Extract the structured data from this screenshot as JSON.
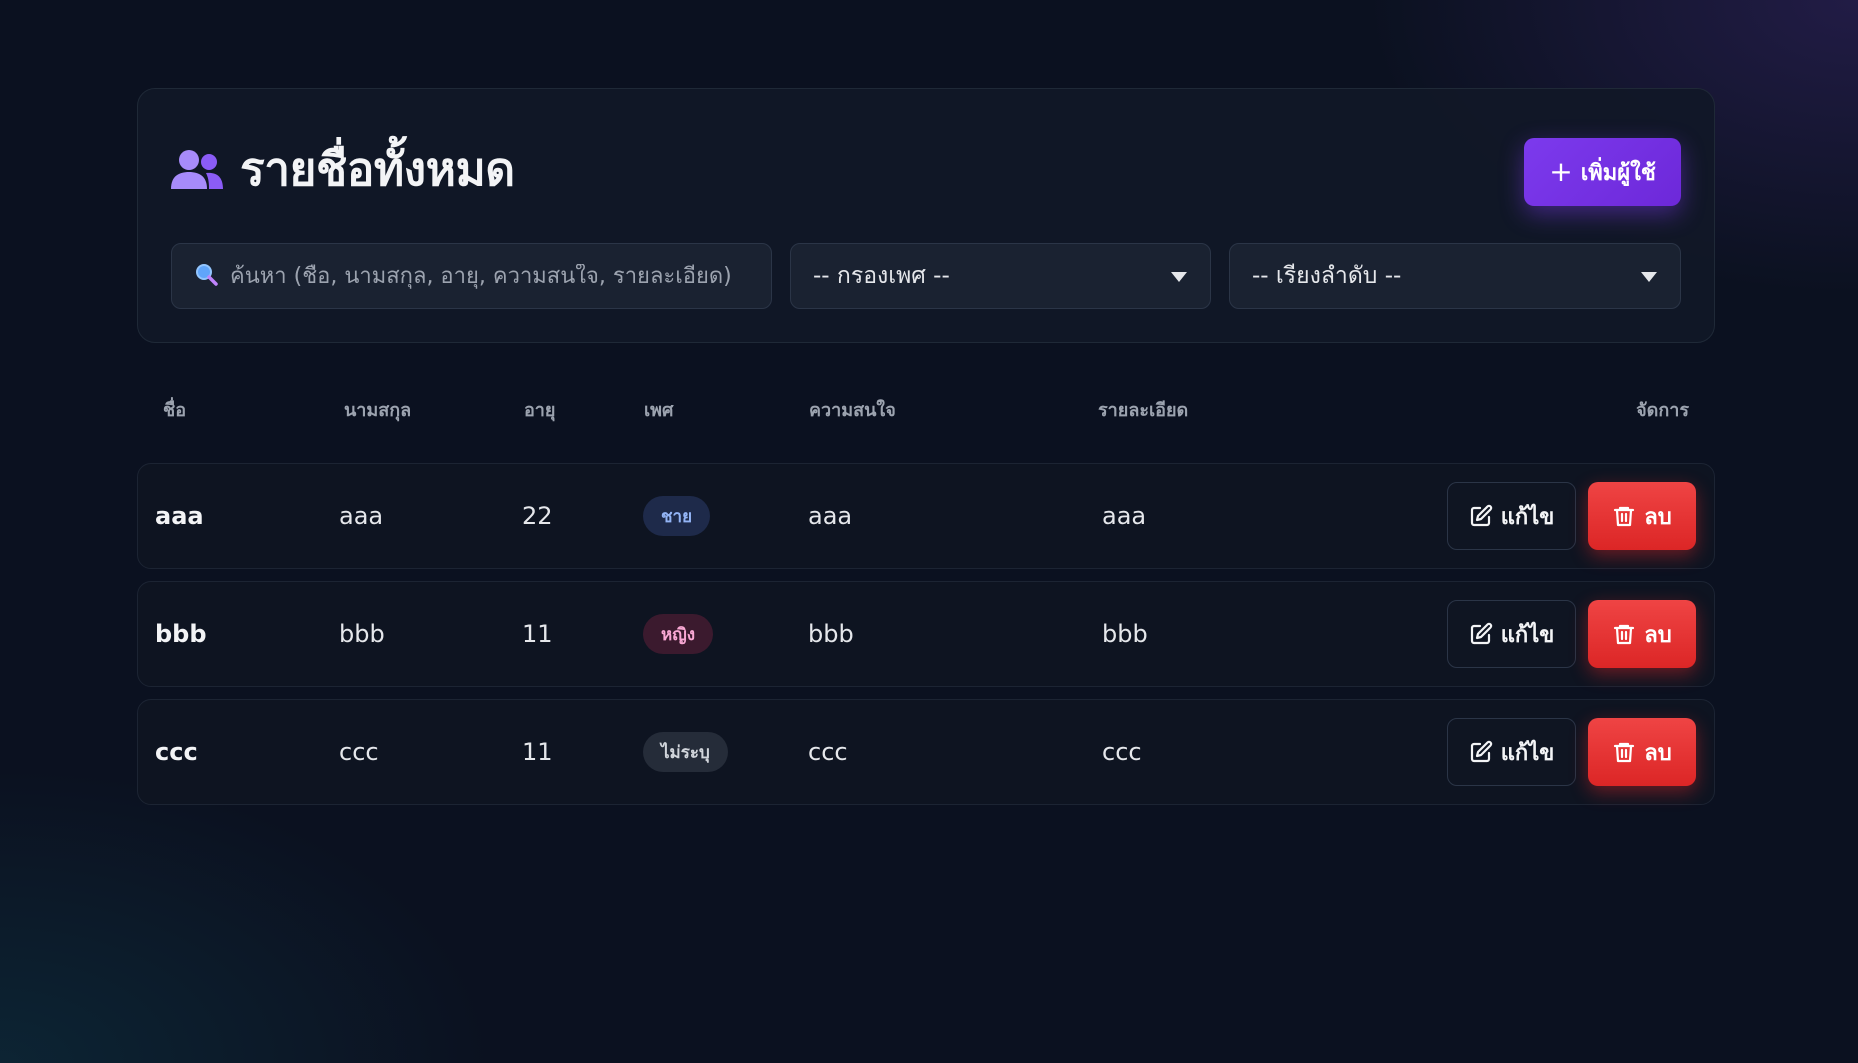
{
  "header": {
    "title": "รายชื่อทั้งหมด",
    "add_button_label": "เพิ่มผู้ใช้",
    "add_button_icon": "plus-icon",
    "title_icon": "users-icon",
    "accent_color": "#7c3aed"
  },
  "filters": {
    "search_placeholder": "ค้นหา (ชื่อ, นามสกุล, อายุ, ความสนใจ, รายละเอียด)",
    "search_value": "",
    "gender_selected": "-- กรองเพศ --",
    "sort_selected": "-- เรียงลำดับ --"
  },
  "table": {
    "columns": [
      "ชื่อ",
      "นามสกุล",
      "อายุ",
      "เพศ",
      "ความสนใจ",
      "รายละเอียด",
      "จัดการ"
    ],
    "rows": [
      {
        "first_name": "aaa",
        "last_name": "aaa",
        "age": "22",
        "gender": "ชาย",
        "interest": "aaa",
        "details": "aaa"
      },
      {
        "first_name": "bbb",
        "last_name": "bbb",
        "age": "11",
        "gender": "หญิง",
        "interest": "bbb",
        "details": "bbb"
      },
      {
        "first_name": "ccc",
        "last_name": "ccc",
        "age": "11",
        "gender": "ไม่ระบุ",
        "interest": "ccc",
        "details": "ccc"
      }
    ],
    "edit_label": "แก้ไข",
    "delete_label": "ลบ",
    "badge_colors": {
      "ชาย": {
        "bg": "#1e2a4a",
        "fg": "#93b4f5"
      },
      "หญิง": {
        "bg": "#3b1a2e",
        "fg": "#f9a8d4"
      },
      "ไม่ระบุ": {
        "bg": "#252c39",
        "fg": "#d1d5db"
      }
    },
    "delete_color": "#dc2626"
  }
}
